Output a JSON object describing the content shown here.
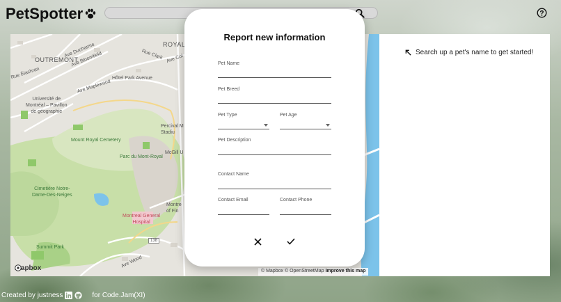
{
  "header": {
    "app_title": "PetSpotter",
    "paw_icon": "paw-icon",
    "search_icon": "search-icon",
    "help_icon": "help-icon"
  },
  "map": {
    "labels": {
      "outremont": "OUTREMONT",
      "ave_ducharme": "Ave Ducharme",
      "ave_bloomfield": "Ave Bloomfield",
      "rue_elachran": "Rue Élachran",
      "ave_maplewood": "Ave Maplewood",
      "hotel_park": "Hôtel Park Avenue",
      "rue_clark": "Rue Clark",
      "royal": "ROYAL",
      "ave_col": "Ave Col",
      "universite": "Université de\nMontréal – Pavillon\nde géographie",
      "mount_royal_cemetery": "Mount Royal Cemetery",
      "parc_mont_royal": "Parc du Mont-Royal",
      "cimetiere": "Cimetière Notre-\nDame-Des-Neiges",
      "summit_park": "Summit Park",
      "ave_wood": "Ave Wood",
      "montreal_general": "Montreal General\nHospital",
      "percival": "Percival M\nStadiu",
      "mcgill": "McGill U",
      "montre": "Montre\nof Fin",
      "route_138": "138",
      "mapbox_logo": "mapbox"
    },
    "attribution": {
      "mapbox": "© Mapbox",
      "osm": "© OpenStreetMap",
      "improve": "Improve this map"
    }
  },
  "side_panel": {
    "hint": "Search up a pet's name to get started!"
  },
  "modal": {
    "title": "Report new information",
    "fields": {
      "pet_name": "Pet Name",
      "pet_breed": "Pet Breed",
      "pet_type": "Pet Type",
      "pet_age": "Pet Age",
      "pet_description": "Pet Description",
      "contact_name": "Contact Name",
      "contact_email": "Contact Email",
      "contact_phone": "Contact Phone"
    }
  },
  "footer": {
    "created_by": "Created by justness",
    "for_text": "for Code.Jam(XI)"
  },
  "colors": {
    "map_land": "#e6e4de",
    "map_park": "#c8dfa8",
    "map_water": "#7cc3ea",
    "map_road": "#ffffff"
  }
}
